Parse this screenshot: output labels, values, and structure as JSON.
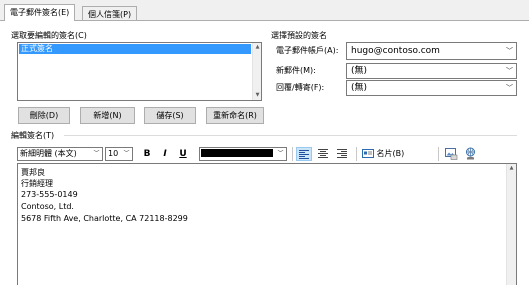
{
  "tabs": [
    {
      "label": "電子郵件簽名(E)",
      "active": true
    },
    {
      "label": "個人信箋(P)",
      "active": false
    }
  ],
  "left": {
    "title": "選取要編輯的簽名(C)",
    "signatures": [
      "正式簽名"
    ],
    "buttons": {
      "delete": "刪除(D)",
      "new": "新增(N)",
      "save": "儲存(S)",
      "rename": "重新命名(R)"
    }
  },
  "right": {
    "title": "選擇預設的簽名",
    "account_label": "電子郵件帳戶(A):",
    "account_value": "hugo@contoso.com",
    "new_messages_label": "新郵件(M):",
    "new_messages_value": "(無)",
    "replies_label": "回覆/轉寄(F):",
    "replies_value": "(無)"
  },
  "editor": {
    "title": "編輯簽名(T)",
    "font_name": "新細明體 (本文)",
    "font_size": "10",
    "bold": "B",
    "italic": "I",
    "underline": "U",
    "font_color": "#000000",
    "business_card_label": "名片(B)",
    "lines": [
      "賈邦良",
      "行銷經理",
      "273-555-0149",
      "Contoso, Ltd.",
      "5678 Fifth Ave, Charlotte, CA 72118-8299"
    ]
  }
}
